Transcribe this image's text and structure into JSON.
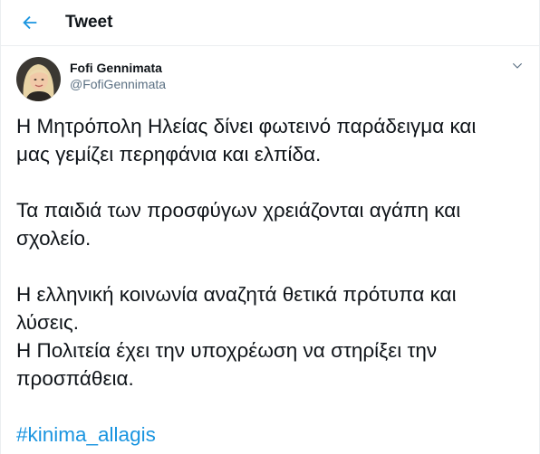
{
  "header": {
    "title": "Tweet"
  },
  "author": {
    "display_name": "Fofi Gennimata",
    "handle": "@FofiGennimata"
  },
  "tweet": {
    "paragraphs": [
      [
        "Η Μητρόπολη Ηλείας δίνει φωτεινό παράδειγμα και",
        "μας γεμίζει περηφάνια και ελπίδα."
      ],
      [
        "Τα παιδιά των προσφύγων χρειάζονται αγάπη και",
        "σχολείο."
      ],
      [
        "Η ελληνική κοινωνία αναζητά θετικά πρότυπα και",
        "λύσεις.",
        "Η Πολιτεία έχει την υποχρέωση να στηρίξει την",
        "προσπάθεια."
      ]
    ],
    "hashtag": "#kinima_allagis"
  },
  "icons": {
    "back": "arrow-left-icon",
    "more": "chevron-down-icon"
  },
  "colors": {
    "accent": "#1b95e0",
    "text": "#0f1419",
    "muted": "#5b7083",
    "border": "#ebeef0"
  }
}
